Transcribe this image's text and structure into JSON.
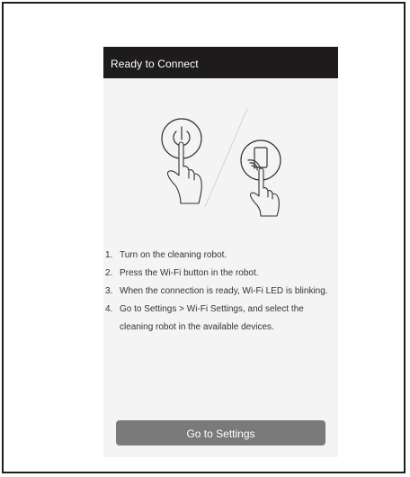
{
  "app_bar": {
    "title": "Ready to Connect"
  },
  "illustration": {
    "left_icon": "power-button-icon",
    "right_icon": "phone-wifi-icon",
    "hand_icon": "pointing-hand-icon"
  },
  "steps": [
    {
      "number": "1.",
      "text": "Turn on the cleaning robot."
    },
    {
      "number": "2.",
      "text": "Press the Wi-Fi button in the robot."
    },
    {
      "number": "3.",
      "text": "When the connection is ready, Wi-Fi LED is blinking."
    },
    {
      "number": "4.",
      "text": "Go to Settings > Wi-Fi Settings, and select the cleaning robot in the available devices."
    }
  ],
  "action": {
    "button_label": "Go to Settings"
  },
  "colors": {
    "app_bar_bg": "#1d1b1b",
    "screen_bg": "#f4f4f4",
    "button_bg": "#7a7a7a"
  }
}
